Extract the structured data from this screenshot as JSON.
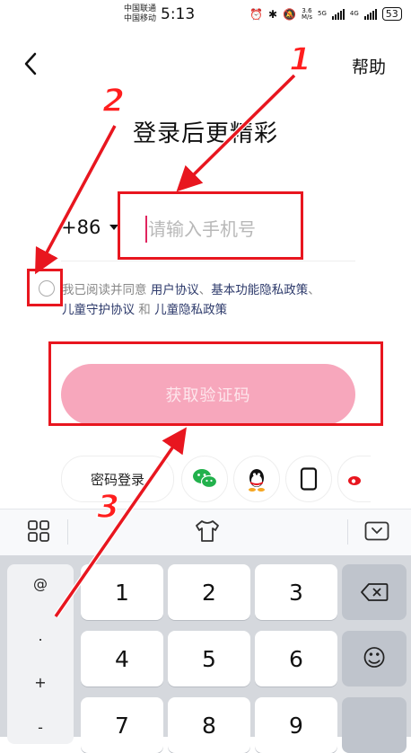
{
  "status_bar": {
    "carrier_1": "中国联通",
    "carrier_2": "中国移动",
    "time": "5:13",
    "net_speed_value": "3.6",
    "net_speed_unit": "M/s",
    "net_1": "5G",
    "net_2": "4G",
    "battery": "53"
  },
  "header": {
    "help_label": "帮助",
    "title": "登录后更精彩"
  },
  "phone": {
    "country_code": "+86",
    "placeholder": "请输入手机号",
    "value": ""
  },
  "agreement": {
    "prefix": "我已阅读并同意 ",
    "link_user": "用户协议",
    "sep_1": "、",
    "link_privacy": "基本功能隐私政策",
    "sep_2": "、",
    "link_child_guard": "儿童守护协议",
    "and": " 和 ",
    "link_child_privacy": "儿童隐私政策",
    "checked": false
  },
  "get_code_label": "获取验证码",
  "alt_login": {
    "password_label": "密码登录",
    "icons": [
      "wechat-icon",
      "qq-icon",
      "phone-icon",
      "weibo-icon"
    ]
  },
  "keyboard": {
    "symbols": [
      "@",
      ".",
      "+",
      "-"
    ],
    "keys": [
      "1",
      "2",
      "3",
      "4",
      "5",
      "6",
      "7",
      "8",
      "9"
    ],
    "emoji_glyph": "☺"
  },
  "annotations": [
    "1",
    "2",
    "3"
  ],
  "colors": {
    "accent_pink": "#f7a7bc",
    "link": "#2d3a6b",
    "annotation_red": "#e8161f"
  }
}
